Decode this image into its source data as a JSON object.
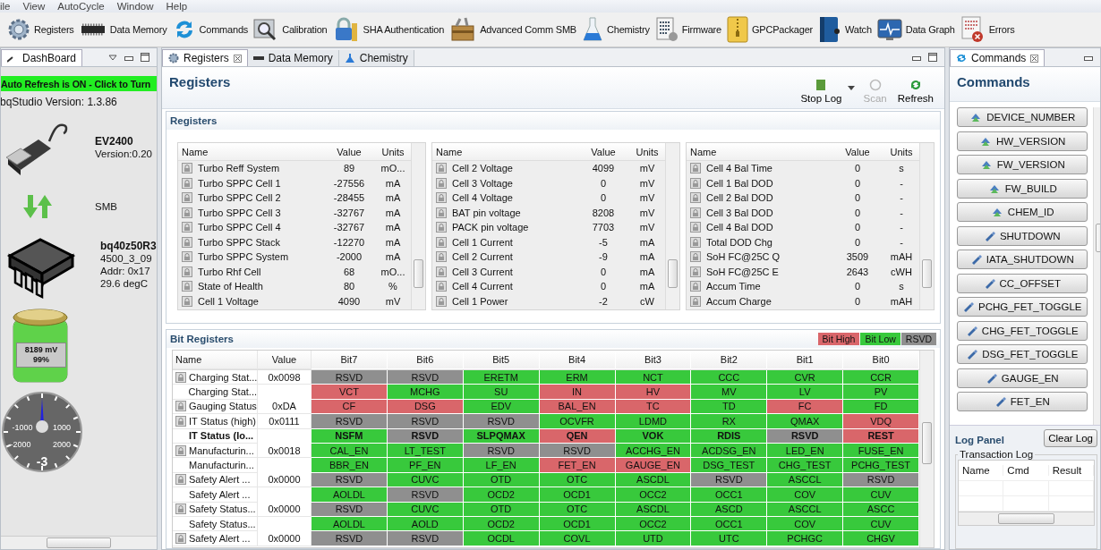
{
  "menu": [
    "ile",
    "View",
    "AutoCycle",
    "Window",
    "Help"
  ],
  "toolbar": [
    {
      "label": "Registers"
    },
    {
      "label": "Data Memory"
    },
    {
      "label": "Commands"
    },
    {
      "label": "Calibration"
    },
    {
      "label": "SHA Authentication"
    },
    {
      "label": "Advanced Comm SMB"
    },
    {
      "label": "Chemistry"
    },
    {
      "label": "Firmware"
    },
    {
      "label": "GPCPackager"
    },
    {
      "label": "Watch"
    },
    {
      "label": "Data Graph"
    },
    {
      "label": "Errors"
    }
  ],
  "dashboard": {
    "tab": "DashBoard",
    "auto_refresh": "Auto Refresh is ON - Click to Turn",
    "version": "bqStudio Version:  1.3.86",
    "adapter": {
      "name": "EV2400",
      "version": "Version:0.20"
    },
    "bus": "SMB",
    "device": {
      "name": "bq40z50R3",
      "lines": [
        "4500_3_09",
        "Addr: 0x17",
        "29.6 degC"
      ]
    },
    "battery": {
      "voltage": "8189 mV",
      "percent": "99%",
      "level": 0.99
    },
    "gauge": {
      "ticks": [
        "-1000",
        "1000",
        "-2000",
        "2000"
      ],
      "reading": "-3"
    }
  },
  "center": {
    "tabs": [
      {
        "label": "Registers",
        "selected": true,
        "closable": true
      },
      {
        "label": "Data Memory",
        "selected": false,
        "closable": false
      },
      {
        "label": "Chemistry",
        "selected": false,
        "closable": false
      }
    ],
    "title": "Registers",
    "actions": [
      {
        "label": "Stop Log",
        "disabled": false,
        "dropdown": true
      },
      {
        "label": "Scan",
        "disabled": true,
        "dropdown": false
      },
      {
        "label": "Refresh",
        "disabled": false,
        "dropdown": false
      }
    ],
    "registers": {
      "title": "Registers",
      "tables": [
        {
          "columns": [
            "Name",
            "Value",
            "Units"
          ],
          "rows": [
            [
              "Turbo Reff System",
              "89",
              "mO..."
            ],
            [
              "Turbo SPPC Cell 1",
              "-27556",
              "mA"
            ],
            [
              "Turbo SPPC Cell 2",
              "-28455",
              "mA"
            ],
            [
              "Turbo SPPC Cell 3",
              "-32767",
              "mA"
            ],
            [
              "Turbo SPPC Cell 4",
              "-32767",
              "mA"
            ],
            [
              "Turbo SPPC Stack",
              "-12270",
              "mA"
            ],
            [
              "Turbo SPPC System",
              "-2000",
              "mA"
            ],
            [
              "Turbo Rhf Cell",
              "68",
              "mO..."
            ],
            [
              "State of Health",
              "80",
              "%"
            ],
            [
              "Cell 1 Voltage",
              "4090",
              "mV"
            ]
          ]
        },
        {
          "columns": [
            "Name",
            "Value",
            "Units"
          ],
          "rows": [
            [
              "Cell 2 Voltage",
              "4099",
              "mV"
            ],
            [
              "Cell 3 Voltage",
              "0",
              "mV"
            ],
            [
              "Cell 4 Voltage",
              "0",
              "mV"
            ],
            [
              "BAT pin voltage",
              "8208",
              "mV"
            ],
            [
              "PACK pin voltage",
              "7703",
              "mV"
            ],
            [
              "Cell 1 Current",
              "-5",
              "mA"
            ],
            [
              "Cell 2 Current",
              "-9",
              "mA"
            ],
            [
              "Cell 3 Current",
              "0",
              "mA"
            ],
            [
              "Cell 4 Current",
              "0",
              "mA"
            ],
            [
              "Cell 1 Power",
              "-2",
              "cW"
            ]
          ]
        },
        {
          "columns": [
            "Name",
            "Value",
            "Units"
          ],
          "rows": [
            [
              "Cell 4 Bal Time",
              "0",
              "s"
            ],
            [
              "Cell 1 Bal DOD",
              "0",
              "-"
            ],
            [
              "Cell 2 Bal DOD",
              "0",
              "-"
            ],
            [
              "Cell 3 Bal DOD",
              "0",
              "-"
            ],
            [
              "Cell 4 Bal DOD",
              "0",
              "-"
            ],
            [
              "Total DOD Chg",
              "0",
              "-"
            ],
            [
              "SoH FC@25C Q",
              "3509",
              "mAH"
            ],
            [
              "SoH FC@25C E",
              "2643",
              "cWH"
            ],
            [
              "Accum Time",
              "0",
              "s"
            ],
            [
              "Accum Charge",
              "0",
              "mAH"
            ]
          ]
        }
      ]
    },
    "bit_registers": {
      "title": "Bit Registers",
      "legend": [
        {
          "label": "Bit High",
          "color": "#d9666a"
        },
        {
          "label": "Bit Low",
          "color": "#38c93c"
        },
        {
          "label": "RSVD",
          "color": "#8f8f8f"
        }
      ],
      "columns": [
        "Name",
        "Value",
        "Bit7",
        "Bit6",
        "Bit5",
        "Bit4",
        "Bit3",
        "Bit2",
        "Bit1",
        "Bit0"
      ],
      "rows": [
        {
          "name": "Charging Stat...",
          "value": "0x0098",
          "locked": true,
          "bold": false,
          "bits": [
            {
              "label": "RSVD",
              "color": "#8f8f8f"
            },
            {
              "label": "RSVD",
              "color": "#8f8f8f"
            },
            {
              "label": "ERETM",
              "color": "#38c93c"
            },
            {
              "label": "ERM",
              "color": "#38c93c"
            },
            {
              "label": "NCT",
              "color": "#38c93c"
            },
            {
              "label": "CCC",
              "color": "#38c93c"
            },
            {
              "label": "CVR",
              "color": "#38c93c"
            },
            {
              "label": "CCR",
              "color": "#38c93c"
            }
          ]
        },
        {
          "name": "Charging Stat...",
          "locked": false,
          "bold": false,
          "bits": [
            {
              "label": "VCT",
              "color": "#d9666a"
            },
            {
              "label": "MCHG",
              "color": "#38c93c"
            },
            {
              "label": "SU",
              "color": "#38c93c"
            },
            {
              "label": "IN",
              "color": "#d9666a"
            },
            {
              "label": "HV",
              "color": "#d9666a"
            },
            {
              "label": "MV",
              "color": "#38c93c"
            },
            {
              "label": "LV",
              "color": "#38c93c"
            },
            {
              "label": "PV",
              "color": "#38c93c"
            }
          ]
        },
        {
          "name": "Gauging Status",
          "value": "0xDA",
          "locked": true,
          "bold": false,
          "bits": [
            {
              "label": "CF",
              "color": "#d9666a"
            },
            {
              "label": "DSG",
              "color": "#d9666a"
            },
            {
              "label": "EDV",
              "color": "#38c93c"
            },
            {
              "label": "BAL_EN",
              "color": "#d9666a"
            },
            {
              "label": "TC",
              "color": "#d9666a"
            },
            {
              "label": "TD",
              "color": "#38c93c"
            },
            {
              "label": "FC",
              "color": "#d9666a"
            },
            {
              "label": "FD",
              "color": "#38c93c"
            }
          ]
        },
        {
          "name": "IT Status (high)",
          "value": "0x0111",
          "locked": true,
          "bold": false,
          "bits": [
            {
              "label": "RSVD",
              "color": "#8f8f8f"
            },
            {
              "label": "RSVD",
              "color": "#8f8f8f"
            },
            {
              "label": "RSVD",
              "color": "#8f8f8f"
            },
            {
              "label": "OCVFR",
              "color": "#38c93c"
            },
            {
              "label": "LDMD",
              "color": "#38c93c"
            },
            {
              "label": "RX",
              "color": "#38c93c"
            },
            {
              "label": "QMAX",
              "color": "#38c93c"
            },
            {
              "label": "VDQ",
              "color": "#d9666a"
            }
          ]
        },
        {
          "name": "IT Status (lo...",
          "locked": false,
          "bold": true,
          "bits": [
            {
              "label": "NSFM",
              "color": "#38c93c"
            },
            {
              "label": "RSVD",
              "color": "#8f8f8f"
            },
            {
              "label": "SLPQMAX",
              "color": "#38c93c"
            },
            {
              "label": "QEN",
              "color": "#d9666a"
            },
            {
              "label": "VOK",
              "color": "#38c93c"
            },
            {
              "label": "RDIS",
              "color": "#38c93c"
            },
            {
              "label": "RSVD",
              "color": "#8f8f8f"
            },
            {
              "label": "REST",
              "color": "#d9666a"
            }
          ]
        },
        {
          "name": "Manufacturin...",
          "value": "0x0018",
          "locked": true,
          "bold": false,
          "bits": [
            {
              "label": "CAL_EN",
              "color": "#38c93c"
            },
            {
              "label": "LT_TEST",
              "color": "#38c93c"
            },
            {
              "label": "RSVD",
              "color": "#8f8f8f"
            },
            {
              "label": "RSVD",
              "color": "#8f8f8f"
            },
            {
              "label": "ACCHG_EN",
              "color": "#38c93c"
            },
            {
              "label": "ACDSG_EN",
              "color": "#38c93c"
            },
            {
              "label": "LED_EN",
              "color": "#38c93c"
            },
            {
              "label": "FUSE_EN",
              "color": "#38c93c"
            }
          ]
        },
        {
          "name": "Manufacturin...",
          "locked": false,
          "bold": false,
          "bits": [
            {
              "label": "BBR_EN",
              "color": "#38c93c"
            },
            {
              "label": "PF_EN",
              "color": "#38c93c"
            },
            {
              "label": "LF_EN",
              "color": "#38c93c"
            },
            {
              "label": "FET_EN",
              "color": "#d9666a"
            },
            {
              "label": "GAUGE_EN",
              "color": "#d9666a"
            },
            {
              "label": "DSG_TEST",
              "color": "#38c93c"
            },
            {
              "label": "CHG_TEST",
              "color": "#38c93c"
            },
            {
              "label": "PCHG_TEST",
              "color": "#38c93c"
            }
          ]
        },
        {
          "name": "Safety Alert ...",
          "value": "0x0000",
          "locked": true,
          "bold": false,
          "bits": [
            {
              "label": "RSVD",
              "color": "#8f8f8f"
            },
            {
              "label": "CUVC",
              "color": "#38c93c"
            },
            {
              "label": "OTD",
              "color": "#38c93c"
            },
            {
              "label": "OTC",
              "color": "#38c93c"
            },
            {
              "label": "ASCDL",
              "color": "#38c93c"
            },
            {
              "label": "RSVD",
              "color": "#8f8f8f"
            },
            {
              "label": "ASCCL",
              "color": "#38c93c"
            },
            {
              "label": "RSVD",
              "color": "#8f8f8f"
            }
          ]
        },
        {
          "name": "Safety Alert ...",
          "locked": false,
          "bold": false,
          "bits": [
            {
              "label": "AOLDL",
              "color": "#38c93c"
            },
            {
              "label": "RSVD",
              "color": "#8f8f8f"
            },
            {
              "label": "OCD2",
              "color": "#38c93c"
            },
            {
              "label": "OCD1",
              "color": "#38c93c"
            },
            {
              "label": "OCC2",
              "color": "#38c93c"
            },
            {
              "label": "OCC1",
              "color": "#38c93c"
            },
            {
              "label": "COV",
              "color": "#38c93c"
            },
            {
              "label": "CUV",
              "color": "#38c93c"
            }
          ]
        },
        {
          "name": "Safety Status...",
          "value": "0x0000",
          "locked": true,
          "bold": false,
          "bits": [
            {
              "label": "RSVD",
              "color": "#8f8f8f"
            },
            {
              "label": "CUVC",
              "color": "#38c93c"
            },
            {
              "label": "OTD",
              "color": "#38c93c"
            },
            {
              "label": "OTC",
              "color": "#38c93c"
            },
            {
              "label": "ASCDL",
              "color": "#38c93c"
            },
            {
              "label": "ASCD",
              "color": "#38c93c"
            },
            {
              "label": "ASCCL",
              "color": "#38c93c"
            },
            {
              "label": "ASCC",
              "color": "#38c93c"
            }
          ]
        },
        {
          "name": "Safety Status...",
          "locked": false,
          "bold": false,
          "bits": [
            {
              "label": "AOLDL",
              "color": "#38c93c"
            },
            {
              "label": "AOLD",
              "color": "#38c93c"
            },
            {
              "label": "OCD2",
              "color": "#38c93c"
            },
            {
              "label": "OCD1",
              "color": "#38c93c"
            },
            {
              "label": "OCC2",
              "color": "#38c93c"
            },
            {
              "label": "OCC1",
              "color": "#38c93c"
            },
            {
              "label": "COV",
              "color": "#38c93c"
            },
            {
              "label": "CUV",
              "color": "#38c93c"
            }
          ]
        },
        {
          "name": "Safety Alert ...",
          "value": "0x0000",
          "locked": true,
          "bold": false,
          "bits": [
            {
              "label": "RSVD",
              "color": "#8f8f8f"
            },
            {
              "label": "RSVD",
              "color": "#8f8f8f"
            },
            {
              "label": "OCDL",
              "color": "#38c93c"
            },
            {
              "label": "COVL",
              "color": "#38c93c"
            },
            {
              "label": "UTD",
              "color": "#38c93c"
            },
            {
              "label": "UTC",
              "color": "#38c93c"
            },
            {
              "label": "PCHGC",
              "color": "#38c93c"
            },
            {
              "label": "CHGV",
              "color": "#38c93c"
            }
          ]
        }
      ]
    }
  },
  "commands": {
    "tab": "Commands",
    "title": "Commands",
    "buttons": [
      {
        "label": "DEVICE_NUMBER",
        "kind": "read"
      },
      {
        "label": "HW_VERSION",
        "kind": "read"
      },
      {
        "label": "FW_VERSION",
        "kind": "read"
      },
      {
        "label": "FW_BUILD",
        "kind": "read"
      },
      {
        "label": "CHEM_ID",
        "kind": "read"
      },
      {
        "label": "SHUTDOWN",
        "kind": "write"
      },
      {
        "label": "IATA_SHUTDOWN",
        "kind": "write"
      },
      {
        "label": "CC_OFFSET",
        "kind": "write"
      },
      {
        "label": "PCHG_FET_TOGGLE",
        "kind": "write"
      },
      {
        "label": "CHG_FET_TOGGLE",
        "kind": "write"
      },
      {
        "label": "DSG_FET_TOGGLE",
        "kind": "write"
      },
      {
        "label": "GAUGE_EN",
        "kind": "write"
      },
      {
        "label": "FET_EN",
        "kind": "write"
      }
    ],
    "log_panel": {
      "title": "Log Panel",
      "clear": "Clear Log",
      "group": "Transaction Log",
      "columns": [
        "Name",
        "Cmd",
        "Result"
      ]
    }
  }
}
